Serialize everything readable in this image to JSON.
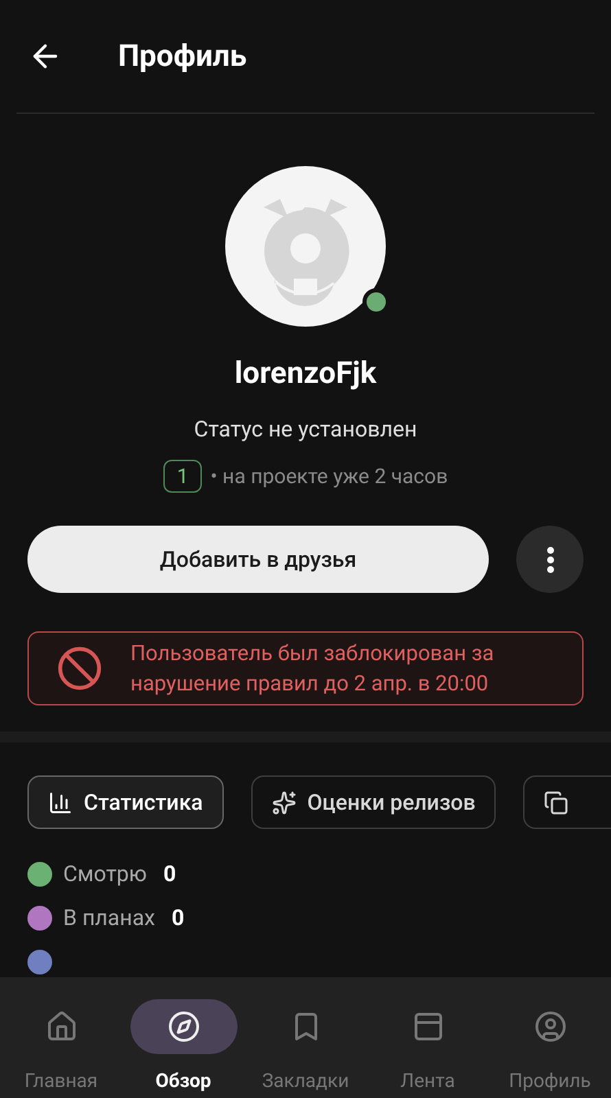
{
  "header": {
    "title": "Профиль"
  },
  "profile": {
    "online": true,
    "username": "lorenzoFjk",
    "status": "Статус не установлен",
    "level": "1",
    "since": "• на проекте уже 2 часов"
  },
  "actions": {
    "add_friend": "Добавить в друзья"
  },
  "alert": {
    "text": "Пользователь был заблокирован за нарушение правил до 2 апр. в 20:00"
  },
  "tabs": [
    {
      "label": "Статистика",
      "selected": true
    },
    {
      "label": "Оценки релизов",
      "selected": false
    },
    {
      "selected": false
    }
  ],
  "stats": [
    {
      "label": "Смотрю",
      "count": "0",
      "color": "#6cb174"
    },
    {
      "label": "В планах",
      "count": "0",
      "color": "#b076c0"
    },
    {
      "color": "#6f7fc0"
    }
  ],
  "nav": [
    {
      "label": "Главная",
      "selected": false
    },
    {
      "label": "Обзор",
      "selected": true
    },
    {
      "label": "Закладки",
      "selected": false
    },
    {
      "label": "Лента",
      "selected": false
    },
    {
      "label": "Профиль",
      "selected": false
    }
  ]
}
